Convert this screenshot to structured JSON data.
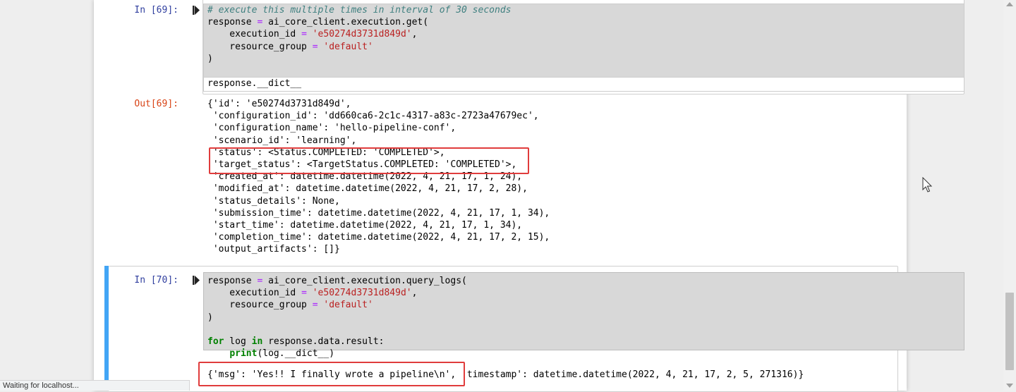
{
  "cell69": {
    "in_prompt": "In [69]:",
    "out_prompt": "Out[69]:",
    "code": [
      {
        "parts": [
          {
            "t": "# execute this multiple times in interval of 30 seconds",
            "c": "cm"
          }
        ]
      },
      {
        "parts": [
          {
            "t": "response ",
            "c": ""
          },
          {
            "t": "=",
            "c": "op"
          },
          {
            "t": " ai_core_client.execution.get(",
            "c": ""
          }
        ]
      },
      {
        "parts": [
          {
            "t": "    execution_id ",
            "c": ""
          },
          {
            "t": "=",
            "c": "op"
          },
          {
            "t": " ",
            "c": ""
          },
          {
            "t": "'e50274d3731d849d'",
            "c": "st"
          },
          {
            "t": ",",
            "c": ""
          }
        ]
      },
      {
        "parts": [
          {
            "t": "    resource_group ",
            "c": ""
          },
          {
            "t": "=",
            "c": "op"
          },
          {
            "t": " ",
            "c": ""
          },
          {
            "t": "'default'",
            "c": "st"
          }
        ]
      },
      {
        "parts": [
          {
            "t": ")",
            "c": ""
          }
        ]
      },
      {
        "parts": [
          {
            "t": "",
            "c": ""
          }
        ]
      },
      {
        "parts": [
          {
            "t": "response.__dict__",
            "c": ""
          }
        ]
      }
    ],
    "output": [
      "{'id': 'e50274d3731d849d',",
      " 'configuration_id': 'dd660ca6-2c1c-4317-a83c-2723a47679ec',",
      " 'configuration_name': 'hello-pipeline-conf',",
      " 'scenario_id': 'learning',",
      " 'status': <Status.COMPLETED: 'COMPLETED'>,",
      " 'target_status': <TargetStatus.COMPLETED: 'COMPLETED'>,",
      " 'created_at': datetime.datetime(2022, 4, 21, 17, 1, 24),",
      " 'modified_at': datetime.datetime(2022, 4, 21, 17, 2, 28),",
      " 'status_details': None,",
      " 'submission_time': datetime.datetime(2022, 4, 21, 17, 1, 34),",
      " 'start_time': datetime.datetime(2022, 4, 21, 17, 1, 34),",
      " 'completion_time': datetime.datetime(2022, 4, 21, 17, 2, 15),",
      " 'output_artifacts': []}"
    ]
  },
  "cell70": {
    "in_prompt": "In [70]:",
    "code": [
      {
        "parts": [
          {
            "t": "response ",
            "c": ""
          },
          {
            "t": "=",
            "c": "op"
          },
          {
            "t": " ai_core_client.execution.query_logs(",
            "c": ""
          }
        ]
      },
      {
        "parts": [
          {
            "t": "    execution_id ",
            "c": ""
          },
          {
            "t": "=",
            "c": "op"
          },
          {
            "t": " ",
            "c": ""
          },
          {
            "t": "'e50274d3731d849d'",
            "c": "st"
          },
          {
            "t": ",",
            "c": ""
          }
        ]
      },
      {
        "parts": [
          {
            "t": "    resource_group ",
            "c": ""
          },
          {
            "t": "=",
            "c": "op"
          },
          {
            "t": " ",
            "c": ""
          },
          {
            "t": "'default'",
            "c": "st"
          }
        ]
      },
      {
        "parts": [
          {
            "t": ")",
            "c": ""
          }
        ]
      },
      {
        "parts": [
          {
            "t": "",
            "c": ""
          }
        ]
      },
      {
        "parts": [
          {
            "t": "for",
            "c": "kw"
          },
          {
            "t": " log ",
            "c": ""
          },
          {
            "t": "in",
            "c": "kw"
          },
          {
            "t": " response.data.result:",
            "c": ""
          }
        ]
      },
      {
        "parts": [
          {
            "t": "    ",
            "c": ""
          },
          {
            "t": "print",
            "c": "kw"
          },
          {
            "t": "(log.__dict__)",
            "c": ""
          }
        ]
      }
    ],
    "output": [
      "{'msg': 'Yes!! I finally wrote a pipeline\\n', 'timestamp': datetime.datetime(2022, 4, 21, 17, 2, 5, 271316)}"
    ]
  },
  "status_bar": {
    "text": "Waiting for localhost..."
  },
  "colors": {
    "highlight_box": "#e03c3c",
    "selected_cell": "#42a5f5",
    "in_prompt": "#303f9f",
    "out_prompt": "#d84315"
  }
}
